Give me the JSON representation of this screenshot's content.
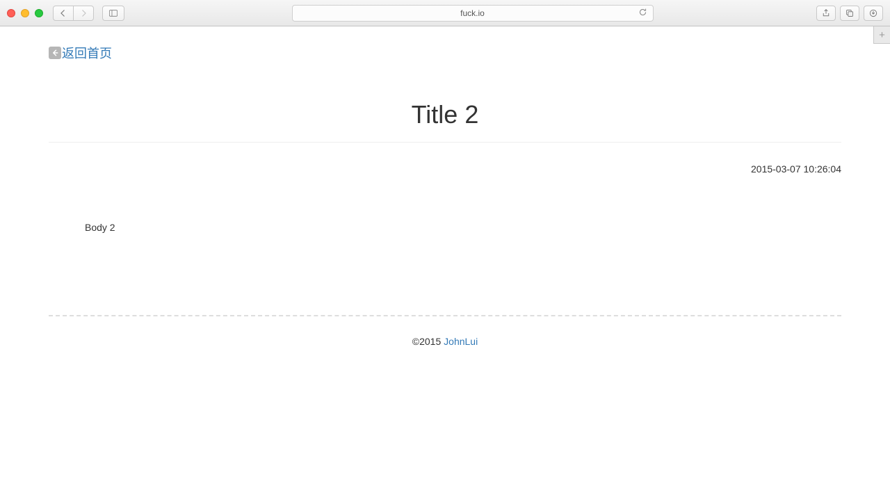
{
  "browser": {
    "url": "fuck.io"
  },
  "nav": {
    "back_home_label": "返回首页"
  },
  "article": {
    "title": "Title 2",
    "date": "2015-03-07 10:26:04",
    "body": "Body 2"
  },
  "footer": {
    "copyright": "©2015 ",
    "author": "JohnLui"
  }
}
